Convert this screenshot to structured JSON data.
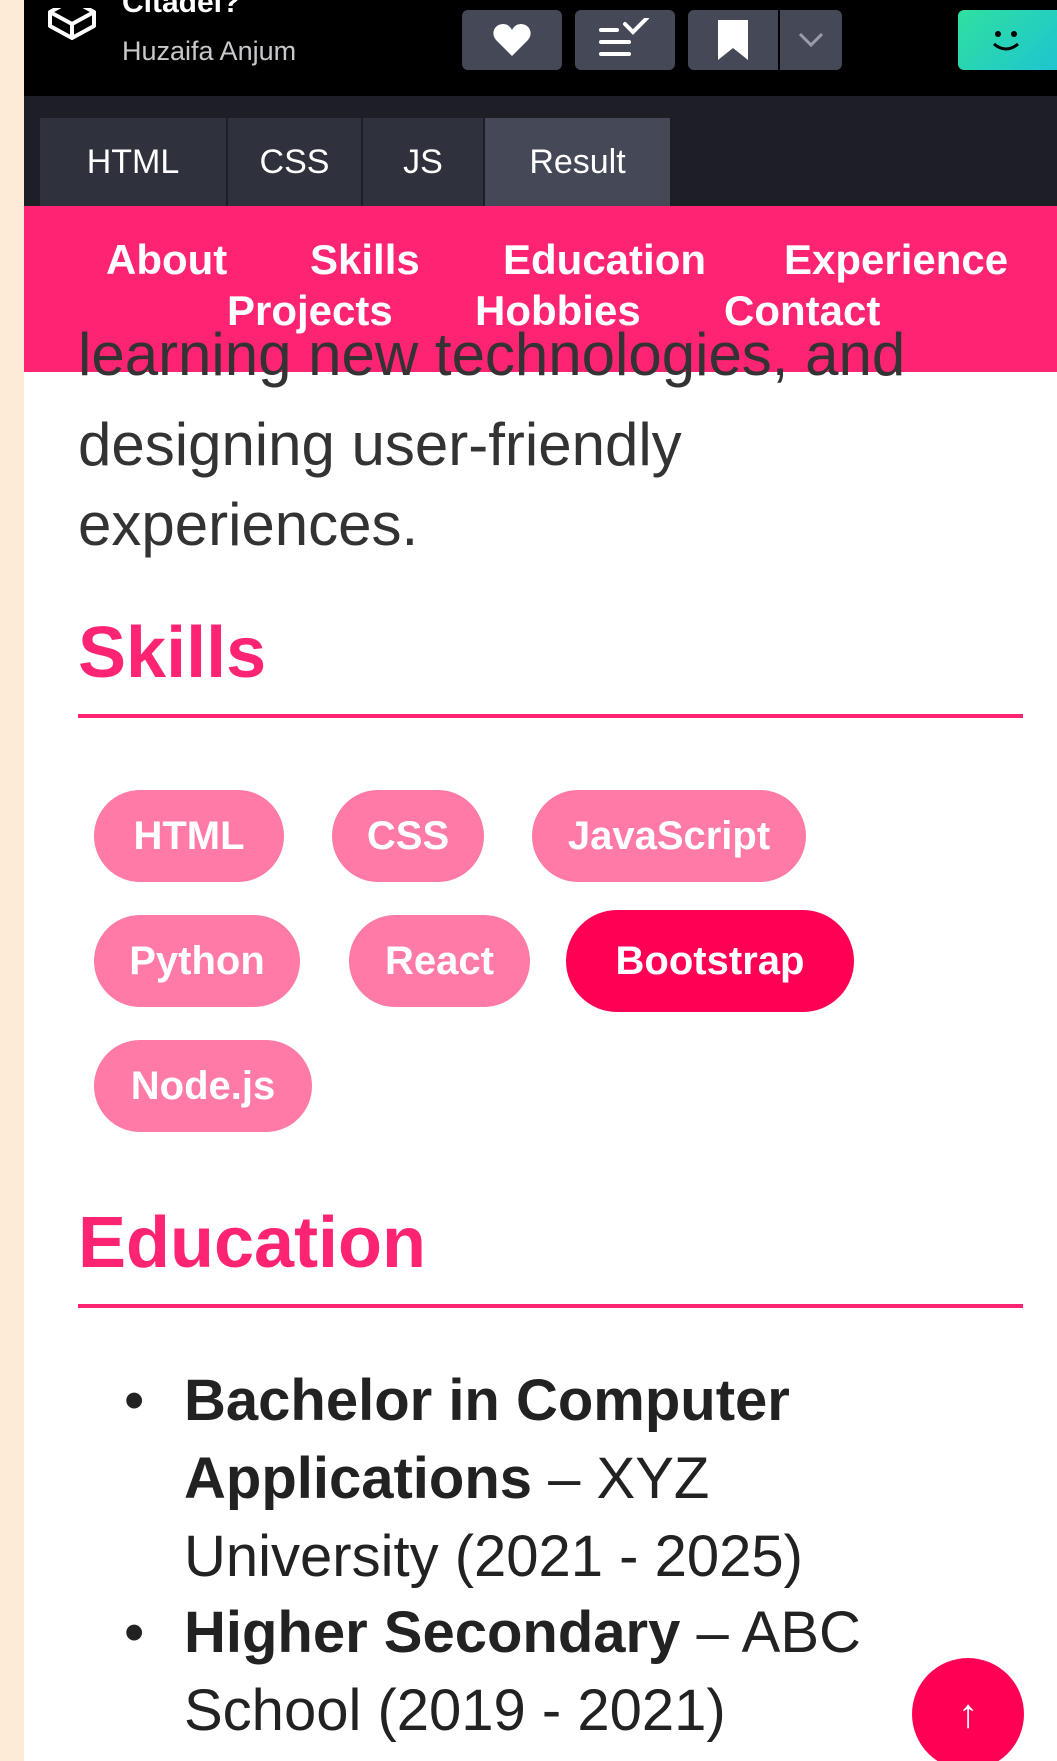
{
  "header": {
    "title_fragment": "Citadel?",
    "author": "Huzaifa Anjum",
    "toolbar_icons": [
      "heart-icon",
      "list-check-icon",
      "bookmark-icon",
      "chevron-down-icon"
    ]
  },
  "editor_tabs": [
    "HTML",
    "CSS",
    "JS",
    "Result"
  ],
  "site_nav": {
    "row1": [
      "About",
      "Skills",
      "Education",
      "Experience"
    ],
    "row2": [
      "Projects",
      "Hobbies",
      "Contact"
    ]
  },
  "about": {
    "cut_line": "learning new technologies, and",
    "line1": "designing user-friendly",
    "line2": "experiences."
  },
  "skills": {
    "title": "Skills",
    "items": [
      "HTML",
      "CSS",
      "JavaScript",
      "Python",
      "React",
      "Bootstrap",
      "Node.js"
    ],
    "highlighted": "Bootstrap"
  },
  "education": {
    "title": "Education",
    "items": [
      {
        "degree_line1": "Bachelor in Computer",
        "degree_line2": "Applications",
        "rest_line2": " – XYZ",
        "rest_line3": "University (2021 - 2025)"
      },
      {
        "degree_line1": "Higher Secondary",
        "rest_line1": " – ABC",
        "rest_line2": "School (2019 - 2021)"
      }
    ]
  },
  "scroll_top": {
    "label": "↑"
  },
  "colors": {
    "accent": "#ff2374",
    "chip": "#ff7aa6",
    "chip_active": "#ff0055",
    "background_outer": "#fdebd6"
  }
}
